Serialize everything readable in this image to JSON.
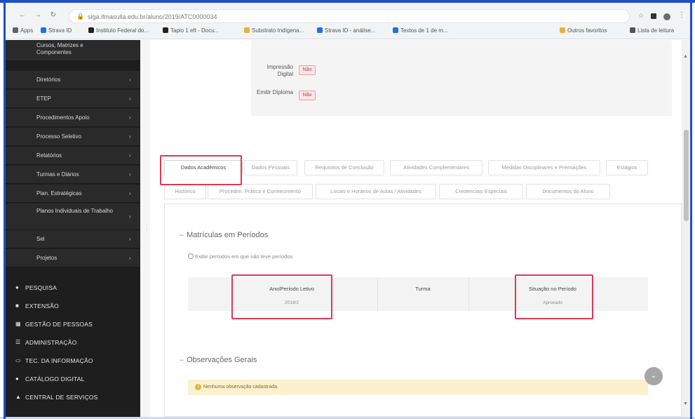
{
  "browser": {
    "url": "siga.ifmasulla.edu.br/aluno/2019/ATC0000034",
    "bookmarks": [
      {
        "label": "Apps",
        "color": "#5f6368"
      },
      {
        "label": "Strava ID",
        "color": "#1a73e8"
      },
      {
        "label": "Instituto Federal do...",
        "color": "#222222"
      },
      {
        "label": "Tapio 1 eft - Docu...",
        "color": "#222222"
      },
      {
        "label": "Substrato Indígena...",
        "color": "#e2b53a"
      },
      {
        "label": "Strava ID - análise...",
        "color": "#1a73e8"
      },
      {
        "label": "Textos de 1 de m...",
        "color": "#1a73e8"
      }
    ],
    "bookmarks_right": [
      "Outros favoritos",
      "Lista de leitura"
    ]
  },
  "sidebar": {
    "submenu_items": [
      {
        "label": "Cursos, Matrizes e Componentes",
        "two_line": true
      },
      {
        "label": "Diretórios"
      },
      {
        "label": "ETEP"
      },
      {
        "label": "Procedimentos Apoio"
      },
      {
        "label": "Processo Seletivo"
      },
      {
        "label": "Relatórios"
      },
      {
        "label": "Turmas e Diários"
      },
      {
        "label": "Plan. Estratégicas"
      },
      {
        "label": "Planos Individuais de Trabalho",
        "two_line": true
      },
      {
        "label": "Sel"
      },
      {
        "label": "Projetos"
      }
    ],
    "main_items": [
      {
        "label": "PESQUISA",
        "icon": "flask-icon",
        "glyph": "●"
      },
      {
        "label": "EXTENSÃO",
        "icon": "extension-icon",
        "glyph": "■"
      },
      {
        "label": "GESTÃO DE PESSOAS",
        "icon": "people-icon",
        "glyph": "▦"
      },
      {
        "label": "ADMINISTRAÇÃO",
        "icon": "admin-icon",
        "glyph": "☰"
      },
      {
        "label": "TEC. DA INFORMAÇÃO",
        "icon": "monitor-icon",
        "glyph": "▭"
      },
      {
        "label": "CATÁLOGO DIGITAL",
        "icon": "book-icon",
        "glyph": "●"
      },
      {
        "label": "CENTRAL DE SERVIÇOS",
        "icon": "service-icon",
        "glyph": "▲"
      }
    ]
  },
  "info_panel": {
    "rows": [
      {
        "label": "Impressão Digital",
        "value": "Não"
      },
      {
        "label": "Emitir Diploma",
        "value": "Não"
      }
    ]
  },
  "tabs": {
    "row1": [
      "Dados Acadêmicos",
      "Dados Pessoais",
      "Requisitos de Conclusão",
      "Atividades Complementares",
      "Medidas Disciplinares e Premiações",
      "Estágios"
    ],
    "row2": [
      "Histórico",
      "Procedim. Prática e Conhecimento",
      "Locais e Horários de Aulas / Atividades",
      "Credenciais Especiais",
      "Documentos do Aluno"
    ]
  },
  "section1": {
    "title": "Matrículas em Períodos",
    "checkbox_label": "Exibir períodos em que não teve períodos"
  },
  "table": {
    "headers": [
      "Ano/Período Letivo",
      "Turma",
      "Situação no Período"
    ],
    "rows": [
      [
        "2019/2",
        "",
        "Aprovado"
      ]
    ]
  },
  "section2": {
    "title": "Observações Gerais",
    "alert_text": "Nenhuma observação cadastrada."
  },
  "colors": {
    "highlight": "#d93a57",
    "sidebar_bg": "#1e1e1e",
    "alert_bg": "#fbf1cf",
    "frame": "#1f4fc4"
  }
}
